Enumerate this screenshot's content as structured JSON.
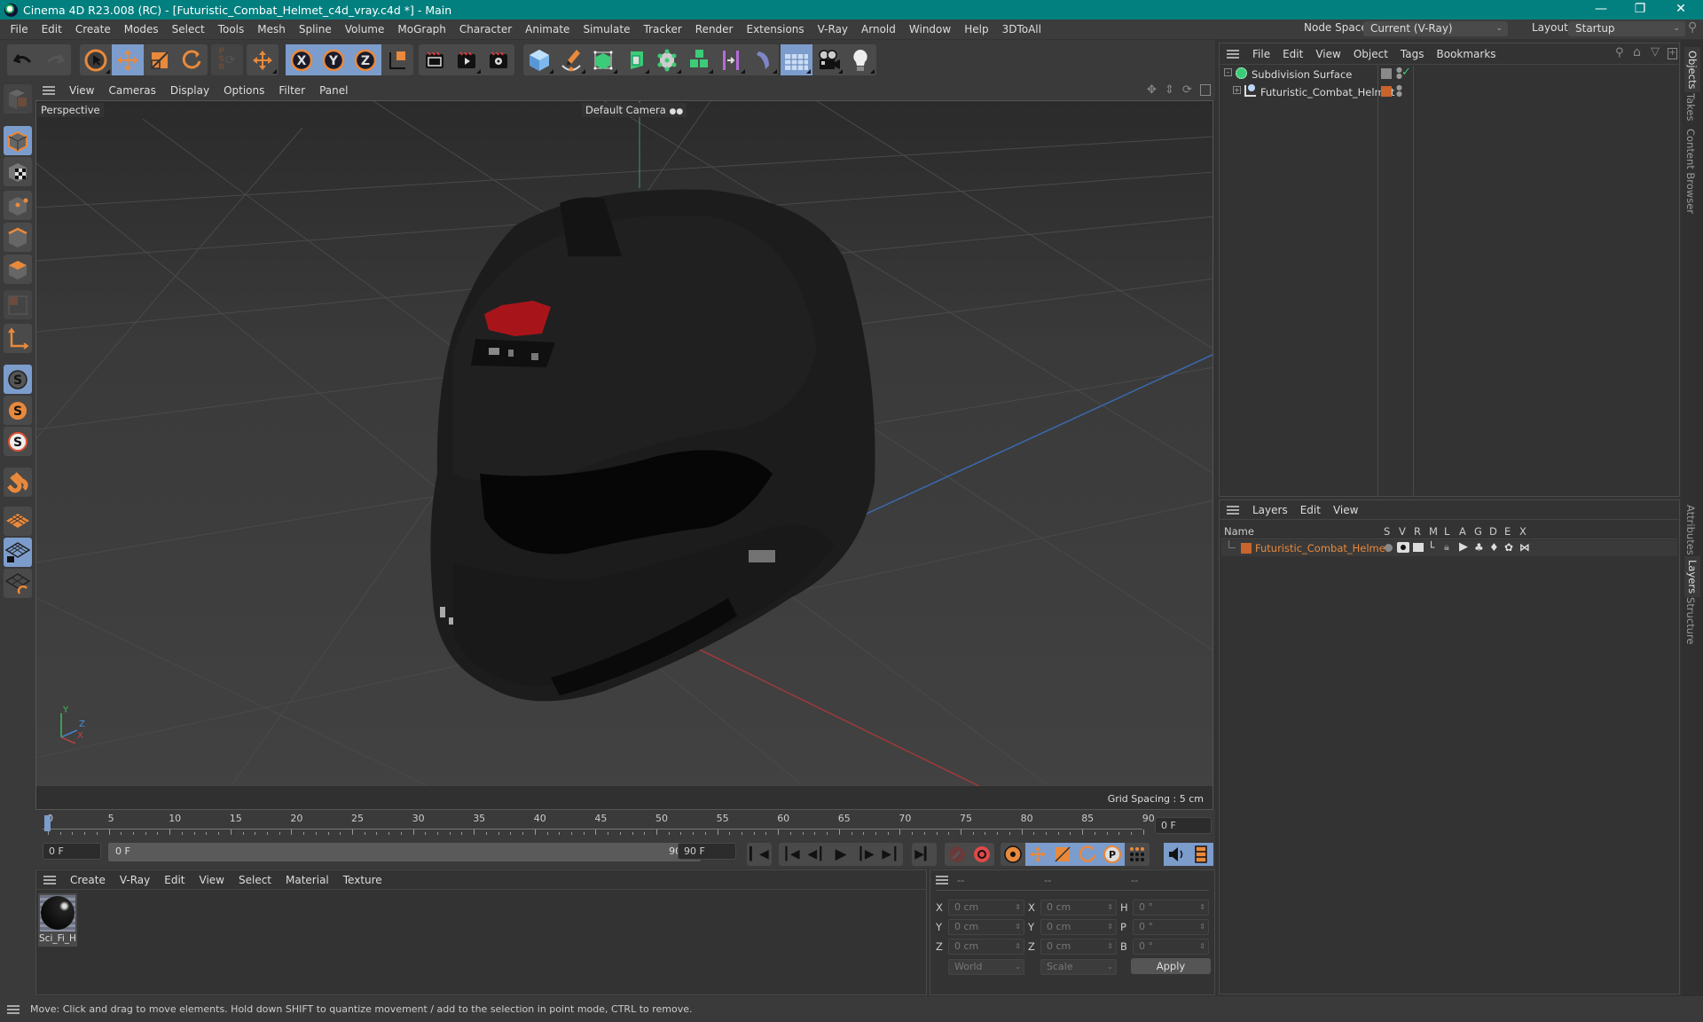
{
  "window": {
    "title": "Cinema 4D R23.008 (RC) - [Futuristic_Combat_Helmet_c4d_vray.c4d *] - Main",
    "controls": [
      "minimize",
      "restore",
      "close"
    ]
  },
  "menubar": {
    "items": [
      "File",
      "Edit",
      "Create",
      "Modes",
      "Select",
      "Tools",
      "Mesh",
      "Spline",
      "Volume",
      "MoGraph",
      "Character",
      "Animate",
      "Simulate",
      "Tracker",
      "Render",
      "Extensions",
      "V-Ray",
      "Arnold",
      "Window",
      "Help",
      "3DToAll"
    ],
    "node_space_label": "Node Space:",
    "node_space_value": "Current (V-Ray)",
    "layout_label": "Layout:",
    "layout_value": "Startup"
  },
  "toolbar": {
    "groups": [
      [
        "undo-icon",
        "redo-icon"
      ],
      [
        "live-selection-icon",
        "move-icon",
        "scale-icon",
        "rotate-icon"
      ],
      [
        "psr-icon"
      ],
      [
        "axis-move-icon"
      ],
      [
        "x-axis-icon",
        "y-axis-icon",
        "z-axis-icon",
        "coordinate-system-icon"
      ],
      [
        "render-view-icon",
        "render-picture-viewer-icon",
        "render-settings-icon"
      ],
      [
        "cube-icon",
        "pen-icon",
        "subdivision-icon",
        "extrude-icon",
        "mograph-cloner-icon",
        "array-icon",
        "bend-deformer-icon",
        "field-icon"
      ],
      [
        "floor-icon",
        "camera-icon",
        "light-icon"
      ]
    ]
  },
  "left_tools": [
    "model-mode-icon",
    "texture-mode-icon",
    "point-mode-icon",
    "edge-mode-icon",
    "polygon-mode-icon",
    "uv-mode-icon",
    "axis-mode-icon",
    "snap-icon",
    "snap-settings-icon",
    "soft-selection-icon",
    "magnet-icon",
    "workplane-icon",
    "locked-workplane-icon",
    "workplane-align-icon"
  ],
  "viewport": {
    "menu": [
      "View",
      "Cameras",
      "Display",
      "Options",
      "Filter",
      "Panel"
    ],
    "view_name": "Perspective",
    "camera": "Default Camera",
    "grid_spacing": "Grid Spacing : 5 cm",
    "axis_labels": {
      "x": "X",
      "y": "Y",
      "z": "Z"
    }
  },
  "timeline": {
    "ticks": [
      "0",
      "5",
      "10",
      "15",
      "20",
      "25",
      "30",
      "35",
      "40",
      "45",
      "50",
      "55",
      "60",
      "65",
      "70",
      "75",
      "80",
      "85",
      "90"
    ],
    "current_frame_display": "0 F",
    "start_field": "0 F",
    "range_start": "0 F",
    "range_end": "90 F",
    "end_field": "90 F"
  },
  "materials": {
    "menu": [
      "Create",
      "V-Ray",
      "Edit",
      "View",
      "Select",
      "Material",
      "Texture"
    ],
    "items": [
      {
        "name": "Sci_Fi_He"
      }
    ]
  },
  "coordinates": {
    "header": [
      "--",
      "--",
      "--"
    ],
    "rows": [
      {
        "l1": "X",
        "v1": "0 cm",
        "l2": "X",
        "v2": "0 cm",
        "l3": "H",
        "v3": "0 °"
      },
      {
        "l1": "Y",
        "v1": "0 cm",
        "l2": "Y",
        "v2": "0 cm",
        "l3": "P",
        "v3": "0 °"
      },
      {
        "l1": "Z",
        "v1": "0 cm",
        "l2": "Z",
        "v2": "0 cm",
        "l3": "B",
        "v3": "0 °"
      }
    ],
    "mode": "World",
    "transform": "Scale",
    "apply": "Apply"
  },
  "objects": {
    "menu": [
      "File",
      "Edit",
      "View",
      "Object",
      "Tags",
      "Bookmarks"
    ],
    "items": [
      {
        "name": "Subdivision Surface",
        "tag_color": "#8a8a8a",
        "check": "✓"
      },
      {
        "name": "Futuristic_Combat_Helmet",
        "tag_color": "#c8642c"
      }
    ]
  },
  "layers": {
    "menu": [
      "Layers",
      "Edit",
      "View"
    ],
    "columns": [
      "Name",
      "S",
      "V",
      "R",
      "M",
      "L",
      "A",
      "G",
      "D",
      "E",
      "X"
    ],
    "items": [
      {
        "name": "Futuristic_Combat_Helmet",
        "color": "#c8642c"
      }
    ]
  },
  "side_tabs": {
    "top": [
      "Objects",
      "Takes",
      "Content Browser"
    ],
    "bottom": [
      "Attributes",
      "Layers",
      "Structure"
    ]
  },
  "status": "Move: Click and drag to move elements. Hold down SHIFT to quantize movement / add to the selection in point mode, CTRL to remove.",
  "colors": {
    "accent": "#e9893b",
    "selected": "#7c9ccc",
    "titlebar": "#02807f"
  }
}
